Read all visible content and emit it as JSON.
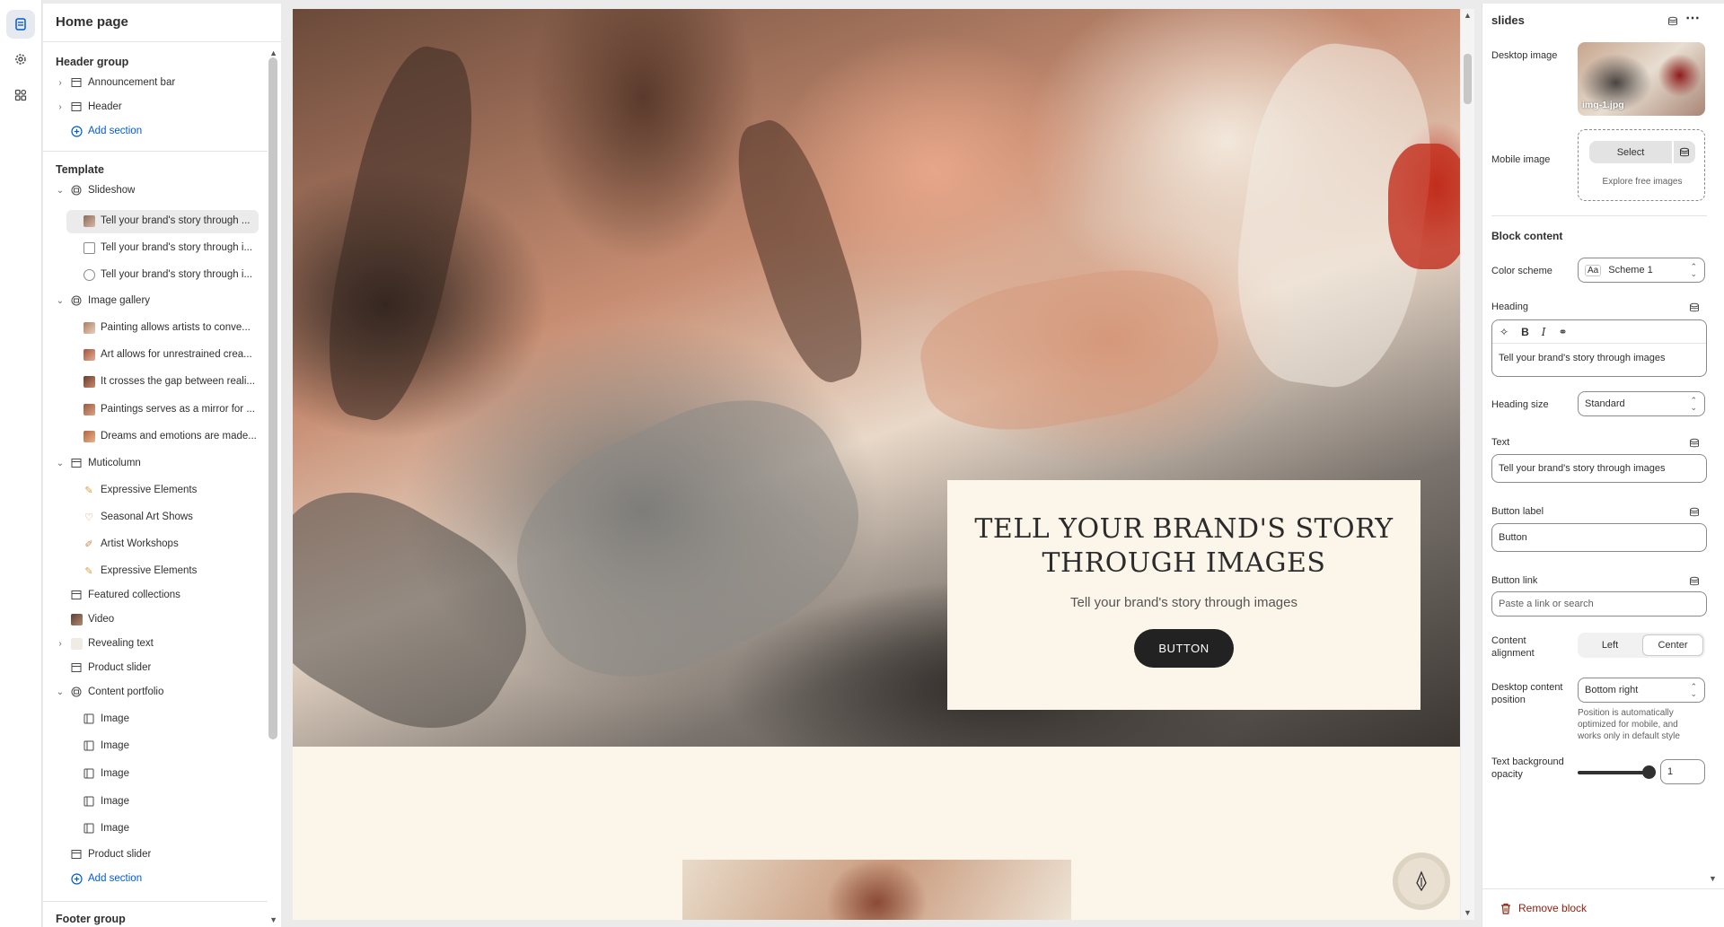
{
  "sidebar": {
    "title": "Home page",
    "header_group_label": "Header group",
    "header_items": [
      "Announcement bar",
      "Header"
    ],
    "add_section": "Add section",
    "template_label": "Template",
    "slideshow": {
      "label": "Slideshow",
      "slides": [
        "Tell your brand's story through ...",
        "Tell your brand's story through i...",
        "Tell your brand's story through i..."
      ]
    },
    "image_gallery": {
      "label": "Image gallery",
      "items": [
        "Painting allows artists to conve...",
        "Art allows for unrestrained crea...",
        "It crosses the gap between reali...",
        "Paintings serves as a mirror for ...",
        "Dreams and emotions are made..."
      ]
    },
    "multicolumn": {
      "label": "Muticolumn",
      "items": [
        "Expressive Elements",
        "Seasonal Art Shows",
        "Artist Workshops",
        "Expressive Elements"
      ]
    },
    "featured_collections": "Featured collections",
    "video": "Video",
    "revealing_text": "Revealing text",
    "product_slider": "Product slider",
    "content_portfolio": {
      "label": "Content portfolio",
      "items": [
        "Image",
        "Image",
        "Image",
        "Image",
        "Image"
      ]
    },
    "product_slider_2": "Product slider",
    "add_section_2": "Add section",
    "footer_group_label": "Footer group"
  },
  "preview": {
    "heading_line1": "TELL YOUR BRAND'S STORY",
    "heading_line2": "THROUGH IMAGES",
    "subheading": "Tell your brand's story through images",
    "button": "BUTTON"
  },
  "panel": {
    "title": "slides",
    "desktop_image_label": "Desktop image",
    "desktop_image_name": "img-1.jpg",
    "mobile_image_label": "Mobile image",
    "select_button": "Select",
    "explore_link": "Explore free images",
    "block_content": "Block content",
    "color_scheme_label": "Color scheme",
    "color_scheme_value": "Scheme 1",
    "heading_label": "Heading",
    "heading_value": "Tell your brand's story through images",
    "heading_size_label": "Heading size",
    "heading_size_value": "Standard",
    "text_label": "Text",
    "text_value": "Tell your brand's story through images",
    "button_label_label": "Button label",
    "button_label_value": "Button",
    "button_link_label": "Button link",
    "button_link_placeholder": "Paste a link or search",
    "content_alignment_label": "Content alignment",
    "alignment_left": "Left",
    "alignment_center": "Center",
    "alignment_selected": "Center",
    "desktop_position_label": "Desktop content position",
    "desktop_position_value": "Bottom right",
    "position_help": "Position is automatically optimized for mobile, and works only in default style",
    "opacity_label": "Text background opacity",
    "opacity_value": "1",
    "remove_block": "Remove block"
  },
  "colors": {
    "link_blue": "#005bd3",
    "critical": "#8e1f0b",
    "preview_bg": "#fcf5ea",
    "button_dark": "#222222"
  }
}
